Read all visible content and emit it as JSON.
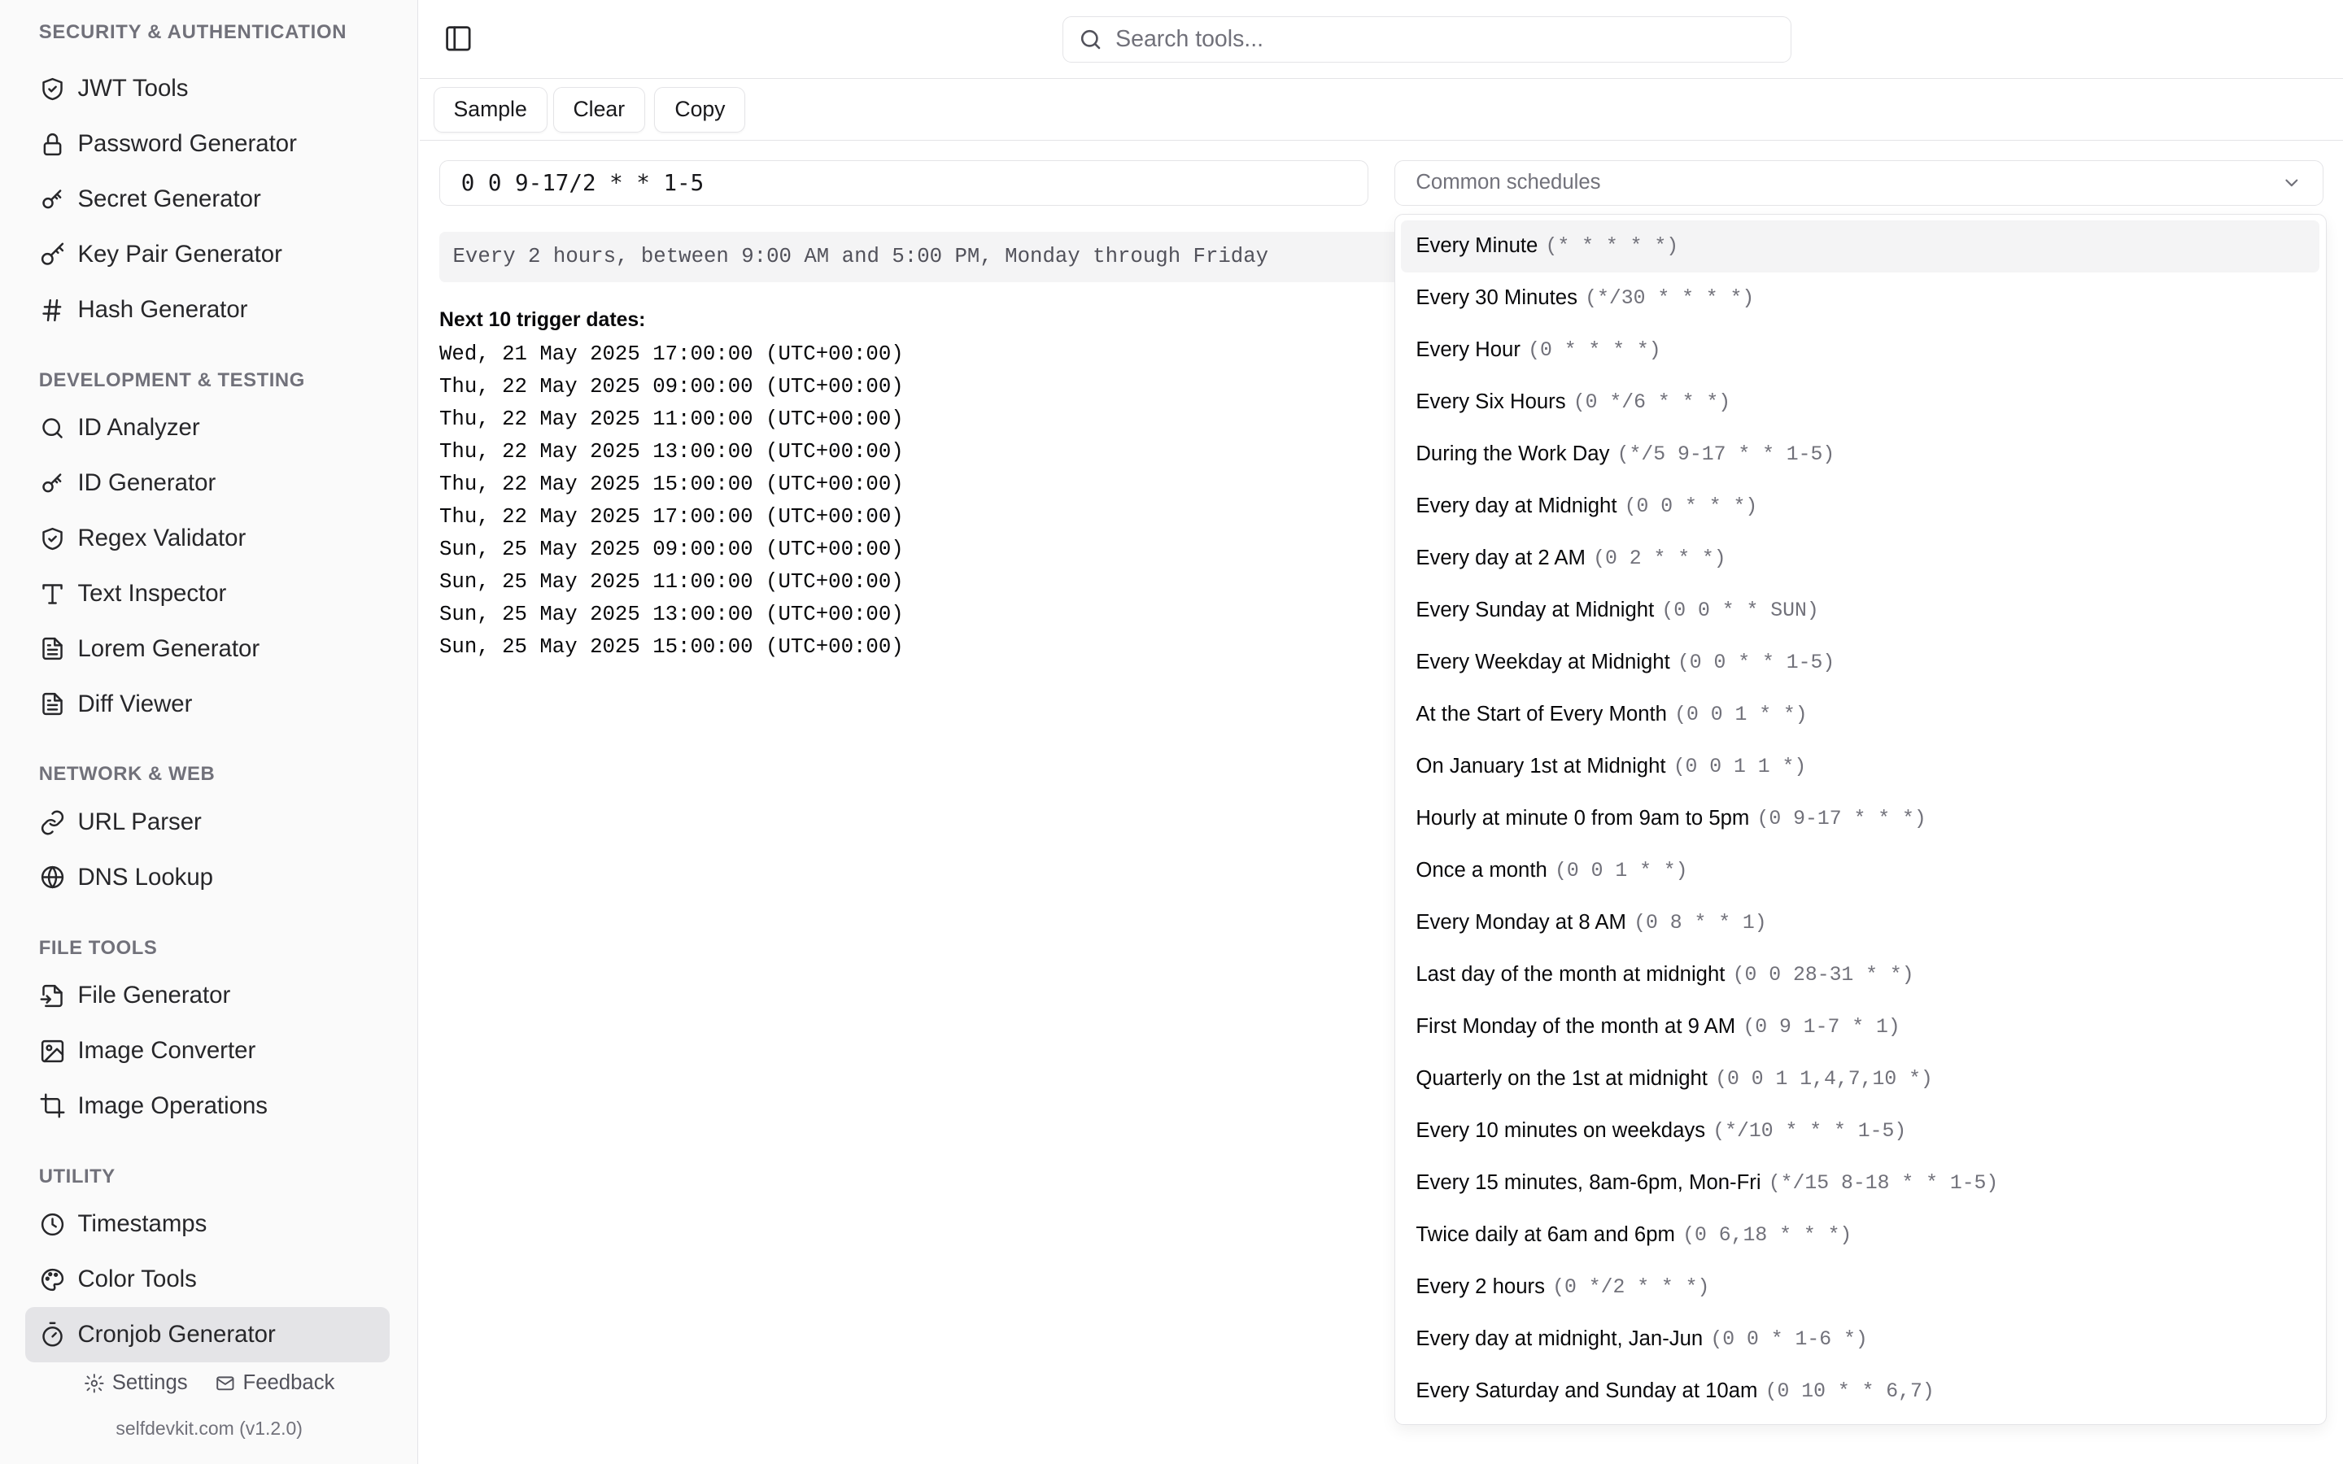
{
  "sidebar": {
    "cut_heading": "SECURITY & AUTHENTICATION",
    "security_items": [
      {
        "label": "JWT Tools",
        "icon": "shield-icon"
      },
      {
        "label": "Password Generator",
        "icon": "lock-icon"
      },
      {
        "label": "Secret Generator",
        "icon": "key-round-icon"
      },
      {
        "label": "Key Pair Generator",
        "icon": "key-icon"
      },
      {
        "label": "Hash Generator",
        "icon": "hash-icon"
      }
    ],
    "dev_label": "DEVELOPMENT & TESTING",
    "dev_items": [
      {
        "label": "ID Analyzer",
        "icon": "search-icon"
      },
      {
        "label": "ID Generator",
        "icon": "key-round-icon"
      },
      {
        "label": "Regex Validator",
        "icon": "shield-icon"
      },
      {
        "label": "Text Inspector",
        "icon": "type-icon"
      },
      {
        "label": "Lorem Generator",
        "icon": "file-text-icon"
      },
      {
        "label": "Diff Viewer",
        "icon": "file-text-icon"
      }
    ],
    "network_label": "NETWORK & WEB",
    "network_items": [
      {
        "label": "URL Parser",
        "icon": "link-icon"
      },
      {
        "label": "DNS Lookup",
        "icon": "globe-icon"
      }
    ],
    "file_label": "FILE TOOLS",
    "file_items": [
      {
        "label": "File Generator",
        "icon": "file-input-icon"
      },
      {
        "label": "Image Converter",
        "icon": "image-icon"
      },
      {
        "label": "Image Operations",
        "icon": "crop-icon"
      }
    ],
    "utility_label": "UTILITY",
    "utility_items": [
      {
        "label": "Timestamps",
        "icon": "clock-icon"
      },
      {
        "label": "Color Tools",
        "icon": "palette-icon"
      },
      {
        "label": "Cronjob Generator",
        "icon": "timer-icon",
        "active": true
      }
    ],
    "settings_label": "Settings",
    "feedback_label": "Feedback",
    "version": "selfdevkit.com (v1.2.0)"
  },
  "header": {
    "search_placeholder": "Search tools..."
  },
  "toolbar": {
    "sample_label": "Sample",
    "clear_label": "Clear",
    "copy_label": "Copy"
  },
  "main": {
    "cron_expression": "0 0 9-17/2 * * 1-5",
    "description": "Every 2 hours, between 9:00 AM and 5:00 PM, Monday through Friday",
    "next_title": "Next 10 trigger dates:",
    "next_dates": [
      "Wed, 21 May 2025 17:00:00 (UTC+00:00)",
      "Thu, 22 May 2025 09:00:00 (UTC+00:00)",
      "Thu, 22 May 2025 11:00:00 (UTC+00:00)",
      "Thu, 22 May 2025 13:00:00 (UTC+00:00)",
      "Thu, 22 May 2025 15:00:00 (UTC+00:00)",
      "Thu, 22 May 2025 17:00:00 (UTC+00:00)",
      "Sun, 25 May 2025 09:00:00 (UTC+00:00)",
      "Sun, 25 May 2025 11:00:00 (UTC+00:00)",
      "Sun, 25 May 2025 13:00:00 (UTC+00:00)",
      "Sun, 25 May 2025 15:00:00 (UTC+00:00)"
    ]
  },
  "schedule_select": {
    "placeholder": "Common schedules",
    "options": [
      {
        "label": "Every Minute",
        "expr": "(* * * * *)"
      },
      {
        "label": "Every 30 Minutes",
        "expr": "(*/30 * * * *)"
      },
      {
        "label": "Every Hour",
        "expr": "(0 * * * *)"
      },
      {
        "label": "Every Six Hours",
        "expr": "(0 */6 * * *)"
      },
      {
        "label": "During the Work Day",
        "expr": "(*/5 9-17 * * 1-5)"
      },
      {
        "label": "Every day at Midnight",
        "expr": "(0 0 * * *)"
      },
      {
        "label": "Every day at 2 AM",
        "expr": "(0 2 * * *)"
      },
      {
        "label": "Every Sunday at Midnight",
        "expr": "(0 0 * * SUN)"
      },
      {
        "label": "Every Weekday at Midnight",
        "expr": "(0 0 * * 1-5)"
      },
      {
        "label": "At the Start of Every Month",
        "expr": "(0 0 1 * *)"
      },
      {
        "label": "On January 1st at Midnight",
        "expr": "(0 0 1 1 *)"
      },
      {
        "label": "Hourly at minute 0 from 9am to 5pm",
        "expr": "(0 9-17 * * *)"
      },
      {
        "label": "Once a month",
        "expr": "(0 0 1 * *)"
      },
      {
        "label": "Every Monday at 8 AM",
        "expr": "(0 8 * * 1)"
      },
      {
        "label": "Last day of the month at midnight",
        "expr": "(0 0 28-31 * *)"
      },
      {
        "label": "First Monday of the month at 9 AM",
        "expr": "(0 9 1-7 * 1)"
      },
      {
        "label": "Quarterly on the 1st at midnight",
        "expr": "(0 0 1 1,4,7,10 *)"
      },
      {
        "label": "Every 10 minutes on weekdays",
        "expr": "(*/10 * * * 1-5)"
      },
      {
        "label": "Every 15 minutes, 8am-6pm, Mon-Fri",
        "expr": "(*/15 8-18 * * 1-5)"
      },
      {
        "label": "Twice daily at 6am and 6pm",
        "expr": "(0 6,18 * * *)"
      },
      {
        "label": "Every 2 hours",
        "expr": "(0 */2 * * *)"
      },
      {
        "label": "Every day at midnight, Jan-Jun",
        "expr": "(0 0 * 1-6 *)"
      },
      {
        "label": "Every Saturday and Sunday at 10am",
        "expr": "(0 10 * * 6,7)"
      }
    ]
  }
}
